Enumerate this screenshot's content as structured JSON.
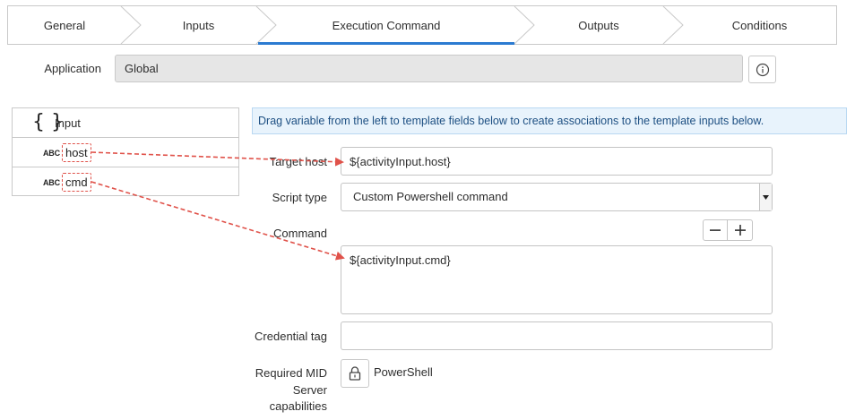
{
  "steps": [
    {
      "label": "General",
      "active": false
    },
    {
      "label": "Inputs",
      "active": false
    },
    {
      "label": "Execution Command",
      "active": true
    },
    {
      "label": "Outputs",
      "active": false
    },
    {
      "label": "Conditions",
      "active": false
    }
  ],
  "application": {
    "label": "Application",
    "value": "Global",
    "info_icon": "info-icon"
  },
  "variables": {
    "root": {
      "icon": "braces-icon",
      "label": "Input"
    },
    "items": [
      {
        "type_badge": "ABC",
        "name": "host"
      },
      {
        "type_badge": "ABC",
        "name": "cmd"
      }
    ]
  },
  "banner": {
    "text": "Drag variable from the left to template fields below to create associations to the template inputs below."
  },
  "form": {
    "target_host": {
      "label": "Target host",
      "value": "${activityInput.host}"
    },
    "script_type": {
      "label": "Script type",
      "value": "Custom Powershell command"
    },
    "command": {
      "label": "Command",
      "value": "${activityInput.cmd}",
      "decrease_icon": "minus-icon",
      "increase_icon": "plus-icon"
    },
    "credential_tag": {
      "label": "Credential tag",
      "value": ""
    },
    "capabilities": {
      "label_lines": [
        "Required MID",
        "Server",
        "capabilities"
      ],
      "lock_icon": "lock-icon",
      "value": "PowerShell"
    }
  },
  "colors": {
    "accent": "#2b7bd1",
    "arrow": "#e0524a",
    "banner_bg": "#e8f3fc",
    "banner_text": "#1d4f82"
  }
}
